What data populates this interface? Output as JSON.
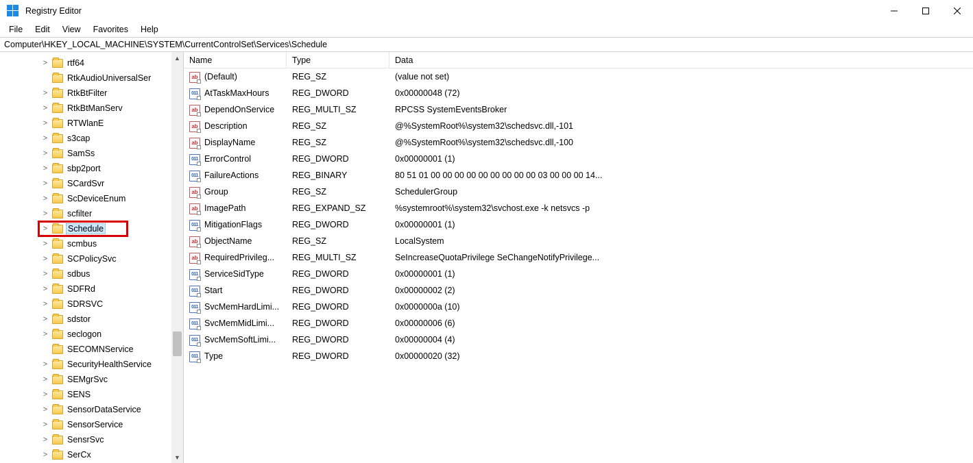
{
  "title": "Registry Editor",
  "menu": [
    "File",
    "Edit",
    "View",
    "Favorites",
    "Help"
  ],
  "address": "Computer\\HKEY_LOCAL_MACHINE\\SYSTEM\\CurrentControlSet\\Services\\Schedule",
  "columns": {
    "name": "Name",
    "type": "Type",
    "data": "Data"
  },
  "tree": [
    {
      "label": "rtf64",
      "exp": true
    },
    {
      "label": "RtkAudioUniversalSer",
      "exp": false
    },
    {
      "label": "RtkBtFilter",
      "exp": true
    },
    {
      "label": "RtkBtManServ",
      "exp": true
    },
    {
      "label": "RTWlanE",
      "exp": true
    },
    {
      "label": "s3cap",
      "exp": true
    },
    {
      "label": "SamSs",
      "exp": true
    },
    {
      "label": "sbp2port",
      "exp": true
    },
    {
      "label": "SCardSvr",
      "exp": true
    },
    {
      "label": "ScDeviceEnum",
      "exp": true
    },
    {
      "label": "scfilter",
      "exp": true
    },
    {
      "label": "Schedule",
      "exp": true,
      "selected": true,
      "highlighted": true
    },
    {
      "label": "scmbus",
      "exp": true
    },
    {
      "label": "SCPolicySvc",
      "exp": true
    },
    {
      "label": "sdbus",
      "exp": true
    },
    {
      "label": "SDFRd",
      "exp": true
    },
    {
      "label": "SDRSVC",
      "exp": true
    },
    {
      "label": "sdstor",
      "exp": true
    },
    {
      "label": "seclogon",
      "exp": true
    },
    {
      "label": "SECOMNService",
      "exp": false
    },
    {
      "label": "SecurityHealthService",
      "exp": true
    },
    {
      "label": "SEMgrSvc",
      "exp": true
    },
    {
      "label": "SENS",
      "exp": true
    },
    {
      "label": "SensorDataService",
      "exp": true
    },
    {
      "label": "SensorService",
      "exp": true
    },
    {
      "label": "SensrSvc",
      "exp": true
    },
    {
      "label": "SerCx",
      "exp": true
    }
  ],
  "values": [
    {
      "icon": "sz",
      "name": "(Default)",
      "type": "REG_SZ",
      "data": "(value not set)"
    },
    {
      "icon": "bin",
      "name": "AtTaskMaxHours",
      "type": "REG_DWORD",
      "data": "0x00000048 (72)"
    },
    {
      "icon": "sz",
      "name": "DependOnService",
      "type": "REG_MULTI_SZ",
      "data": "RPCSS SystemEventsBroker"
    },
    {
      "icon": "sz",
      "name": "Description",
      "type": "REG_SZ",
      "data": "@%SystemRoot%\\system32\\schedsvc.dll,-101"
    },
    {
      "icon": "sz",
      "name": "DisplayName",
      "type": "REG_SZ",
      "data": "@%SystemRoot%\\system32\\schedsvc.dll,-100"
    },
    {
      "icon": "bin",
      "name": "ErrorControl",
      "type": "REG_DWORD",
      "data": "0x00000001 (1)"
    },
    {
      "icon": "bin",
      "name": "FailureActions",
      "type": "REG_BINARY",
      "data": "80 51 01 00 00 00 00 00 00 00 00 00 03 00 00 00 14..."
    },
    {
      "icon": "sz",
      "name": "Group",
      "type": "REG_SZ",
      "data": "SchedulerGroup"
    },
    {
      "icon": "sz",
      "name": "ImagePath",
      "type": "REG_EXPAND_SZ",
      "data": "%systemroot%\\system32\\svchost.exe -k netsvcs -p"
    },
    {
      "icon": "bin",
      "name": "MitigationFlags",
      "type": "REG_DWORD",
      "data": "0x00000001 (1)"
    },
    {
      "icon": "sz",
      "name": "ObjectName",
      "type": "REG_SZ",
      "data": "LocalSystem"
    },
    {
      "icon": "sz",
      "name": "RequiredPrivileg...",
      "type": "REG_MULTI_SZ",
      "data": "SeIncreaseQuotaPrivilege SeChangeNotifyPrivilege..."
    },
    {
      "icon": "bin",
      "name": "ServiceSidType",
      "type": "REG_DWORD",
      "data": "0x00000001 (1)"
    },
    {
      "icon": "bin",
      "name": "Start",
      "type": "REG_DWORD",
      "data": "0x00000002 (2)"
    },
    {
      "icon": "bin",
      "name": "SvcMemHardLimi...",
      "type": "REG_DWORD",
      "data": "0x0000000a (10)"
    },
    {
      "icon": "bin",
      "name": "SvcMemMidLimi...",
      "type": "REG_DWORD",
      "data": "0x00000006 (6)"
    },
    {
      "icon": "bin",
      "name": "SvcMemSoftLimi...",
      "type": "REG_DWORD",
      "data": "0x00000004 (4)"
    },
    {
      "icon": "bin",
      "name": "Type",
      "type": "REG_DWORD",
      "data": "0x00000020 (32)"
    }
  ]
}
